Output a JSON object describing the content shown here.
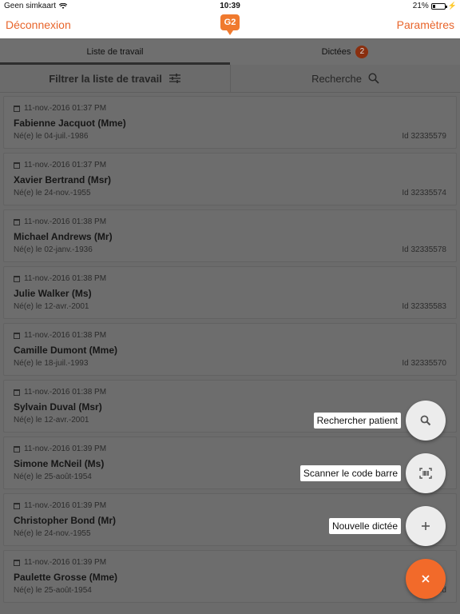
{
  "status_bar": {
    "carrier": "Geen simkaart",
    "time": "10:39",
    "battery": "21%",
    "battery_level": 0.21
  },
  "nav": {
    "left": "Déconnexion",
    "logo": "G2",
    "right": "Paramètres"
  },
  "tabs": [
    {
      "label": "Liste de travail",
      "active": true
    },
    {
      "label": "Dictées",
      "badge": "2",
      "active": false
    }
  ],
  "filter": {
    "filter_label": "Filtrer la liste de travail",
    "search_label": "Recherche"
  },
  "patients": [
    {
      "date": "11-nov.-2016 01:37 PM",
      "name": "Fabienne Jacquot (Mme)",
      "dob": "Né(e) le 04-juil.-1986",
      "id": "Id 32335579"
    },
    {
      "date": "11-nov.-2016 01:37 PM",
      "name": "Xavier Bertrand (Msr)",
      "dob": "Né(e) le 24-nov.-1955",
      "id": "Id 32335574"
    },
    {
      "date": "11-nov.-2016 01:38 PM",
      "name": "Michael Andrews (Mr)",
      "dob": "Né(e) le 02-janv.-1936",
      "id": "Id 32335578"
    },
    {
      "date": "11-nov.-2016 01:38 PM",
      "name": "Julie Walker (Ms)",
      "dob": "Né(e) le 12-avr.-2001",
      "id": "Id 32335583"
    },
    {
      "date": "11-nov.-2016 01:38 PM",
      "name": "Camille Dumont (Mme)",
      "dob": "Né(e) le 18-juil.-1993",
      "id": "Id 32335570"
    },
    {
      "date": "11-nov.-2016 01:38 PM",
      "name": "Sylvain Duval (Msr)",
      "dob": "Né(e) le 12-avr.-2001",
      "id": ""
    },
    {
      "date": "11-nov.-2016 01:39 PM",
      "name": "Simone McNeil (Ms)",
      "dob": "Né(e) le 25-août-1954",
      "id": ""
    },
    {
      "date": "11-nov.-2016 01:39 PM",
      "name": "Christopher Bond (Mr)",
      "dob": "Né(e) le 24-nov.-1955",
      "id": ""
    },
    {
      "date": "11-nov.-2016 01:39 PM",
      "name": "Paulette Grosse (Mme)",
      "dob": "Né(e) le 25-août-1954",
      "id": "Id"
    }
  ],
  "fab_menu": {
    "search_patient": "Rechercher patient",
    "scan_barcode": "Scanner le code barre",
    "new_dictation": "Nouvelle dictée",
    "search_icon": "search-icon",
    "barcode_icon": "barcode-icon",
    "plus_icon": "plus-icon",
    "close_icon": "close-icon"
  },
  "colors": {
    "accent": "#e8652b",
    "fab": "#f26a2a",
    "badge": "#8a2f0f"
  }
}
